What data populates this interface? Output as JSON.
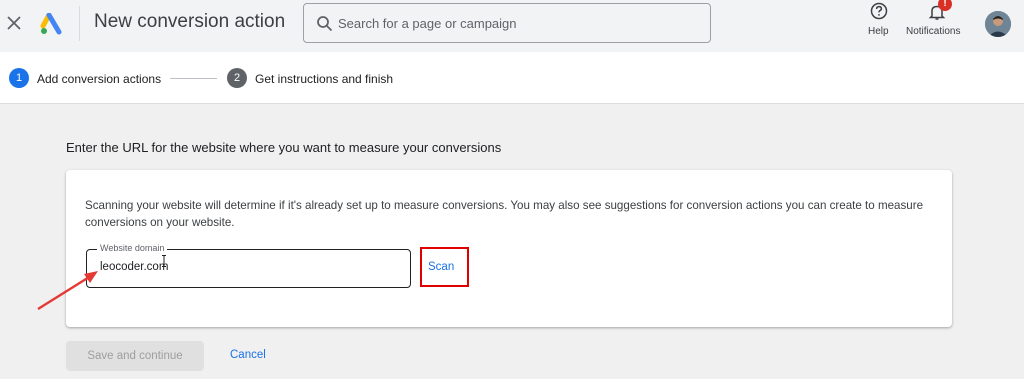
{
  "header": {
    "title": "New conversion action",
    "search_placeholder": "Search for a page or campaign",
    "help_label": "Help",
    "notifications_label": "Notifications",
    "notifications_badge": "!"
  },
  "stepper": {
    "steps": [
      {
        "number": "1",
        "label": "Add conversion actions",
        "active": true
      },
      {
        "number": "2",
        "label": "Get instructions and finish",
        "active": false
      }
    ]
  },
  "main": {
    "section_title": "Enter the URL for the website where you want to measure your conversions",
    "description": "Scanning your website will determine if it's already set up to measure conversions. You may also see suggestions for conversion actions you can create to measure conversions on your website.",
    "domain_field": {
      "label": "Website domain",
      "value": "leocoder.com"
    },
    "scan_label": "Scan",
    "save_label": "Save and continue",
    "cancel_label": "Cancel"
  },
  "colors": {
    "accent": "#1a73e8",
    "annotation_red": "#e00000"
  }
}
